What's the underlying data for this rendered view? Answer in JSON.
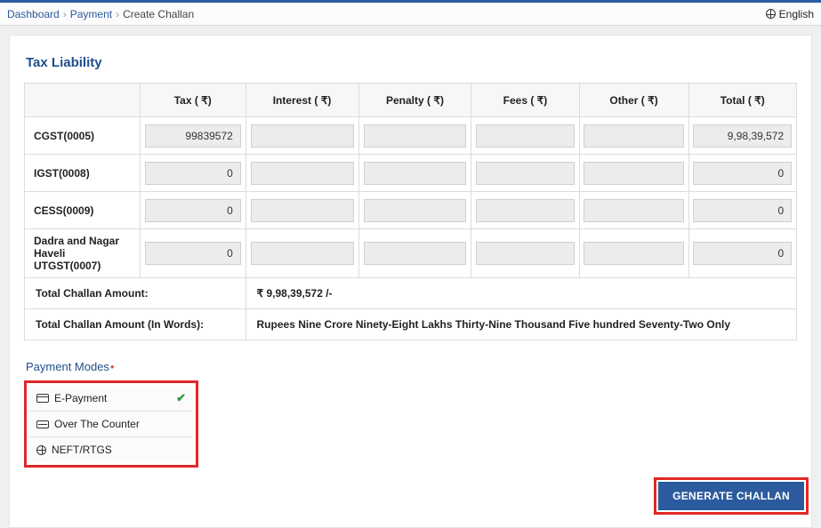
{
  "breadcrumb": {
    "dashboard": "Dashboard",
    "payment": "Payment",
    "current": "Create Challan"
  },
  "language": "English",
  "section_title": "Tax Liability",
  "columns": {
    "blank": "",
    "tax": "Tax ( ₹)",
    "interest": "Interest ( ₹)",
    "penalty": "Penalty ( ₹)",
    "fees": "Fees ( ₹)",
    "other": "Other ( ₹)",
    "total": "Total ( ₹)"
  },
  "rows": [
    {
      "label": "CGST(0005)",
      "tax": "99839572",
      "interest": "",
      "penalty": "",
      "fees": "",
      "other": "",
      "total": "9,98,39,572"
    },
    {
      "label": "IGST(0008)",
      "tax": "0",
      "interest": "",
      "penalty": "",
      "fees": "",
      "other": "",
      "total": "0"
    },
    {
      "label": "CESS(0009)",
      "tax": "0",
      "interest": "",
      "penalty": "",
      "fees": "",
      "other": "",
      "total": "0"
    },
    {
      "label": "Dadra and Nagar Haveli UTGST(0007)",
      "tax": "0",
      "interest": "",
      "penalty": "",
      "fees": "",
      "other": "",
      "total": "0"
    }
  ],
  "footer": {
    "amount_label": "Total Challan Amount:",
    "amount_value": "₹ 9,98,39,572 /-",
    "words_label": "Total Challan Amount (In Words):",
    "words_value": "Rupees Nine Crore Ninety-Eight Lakhs Thirty-Nine Thousand Five hundred Seventy-Two Only"
  },
  "payment_modes": {
    "title": "Payment Modes",
    "items": [
      {
        "label": "E-Payment",
        "selected": true
      },
      {
        "label": "Over The Counter",
        "selected": false
      },
      {
        "label": "NEFT/RTGS",
        "selected": false
      }
    ]
  },
  "generate_button": "GENERATE CHALLAN"
}
